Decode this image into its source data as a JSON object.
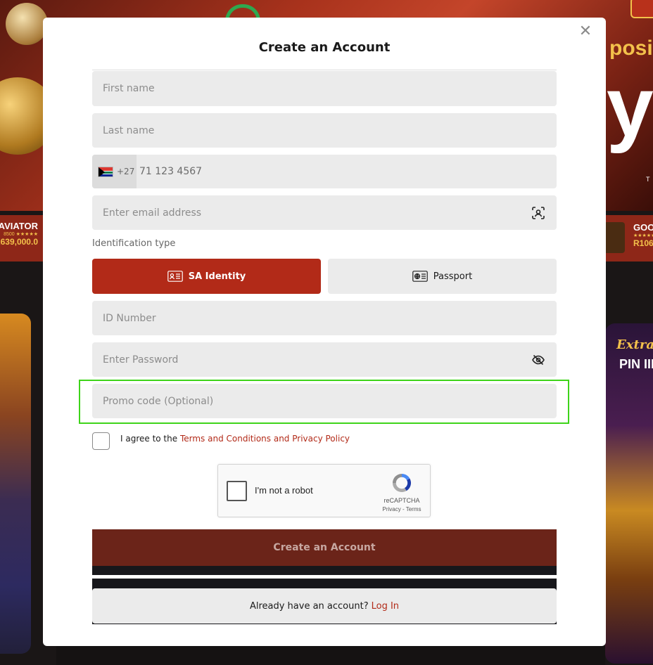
{
  "background": {
    "right_banner_text": "posit",
    "right_banner_big": "y",
    "right_banner_small": "T",
    "ticker_left": {
      "title": "AVIATOR",
      "stars": "★★★★★ 8500",
      "amount": "R639,000.0"
    },
    "ticker_right": {
      "title": "GOO",
      "stars": "★★★★★",
      "amount": "R106"
    },
    "card_right": {
      "title": "Extra",
      "subtitle": "PIN III"
    }
  },
  "modal": {
    "title": "Create an Account",
    "close_icon": "close-icon"
  },
  "form": {
    "first_name_placeholder": "First name",
    "last_name_placeholder": "Last name",
    "phone": {
      "dial_code": "+27",
      "flag": "south-africa-flag",
      "placeholder": "71 123 4567"
    },
    "email_placeholder": "Enter email address",
    "id_type_label": "Identification type",
    "id_types": [
      {
        "label": "SA Identity",
        "selected": true
      },
      {
        "label": "Passport",
        "selected": false
      }
    ],
    "id_number_placeholder": "ID Number",
    "password_placeholder": "Enter Password",
    "promo_placeholder": "Promo code (Optional)",
    "agree_text": "I agree to the",
    "agree_link": "Terms and Conditions and Privacy Policy",
    "recaptcha": {
      "label": "I'm not a robot",
      "brand": "reCAPTCHA",
      "links": "Privacy - Terms"
    },
    "submit_label": "Create an Account",
    "login_prompt": "Already have an account?",
    "login_link": "Log In"
  },
  "colors": {
    "accent": "#b22a18",
    "highlight": "#3ed41a",
    "field_bg": "#ebebeb"
  }
}
